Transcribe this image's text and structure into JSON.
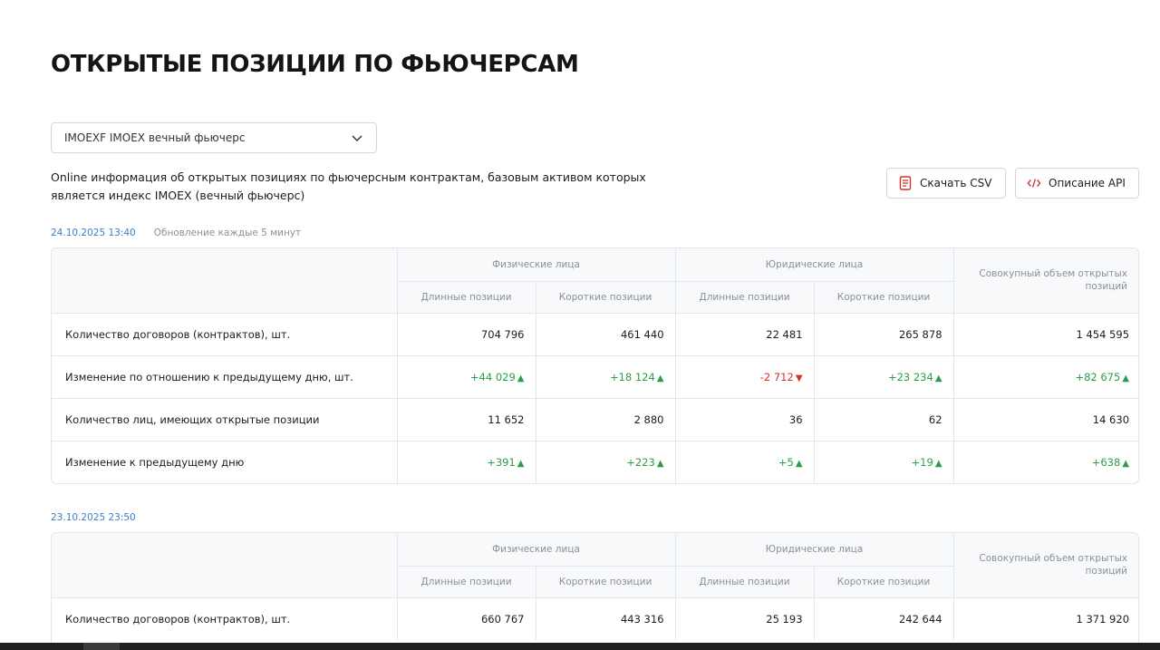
{
  "page": {
    "title": "ОТКРЫТЫЕ ПОЗИЦИИ ПО ФЬЮЧЕРСАМ",
    "description": "Online информация об открытых позициях по фьючерсным контрактам, базовым активом которых является индекс IMOEX (вечный фьючерс)"
  },
  "selector": {
    "value": "IMOEXF IMOEX вечный фьючерс",
    "icon": "chevron-down-icon"
  },
  "buttons": {
    "csv_label": "Скачать CSV",
    "csv_icon": "document-icon",
    "api_label": "Описание API",
    "api_icon": "code-icon"
  },
  "colors": {
    "accent": "#3c7fc4",
    "positive": "#2e9c4b",
    "negative": "#d32f2f",
    "api_icon": "#d32f2f"
  },
  "headers": {
    "individuals": "Физические лица",
    "legal": "Юридические лица",
    "long": "Длинные позиции",
    "short": "Короткие позиции",
    "total": "Совокупный объем открытых позиций"
  },
  "snapshots": [
    {
      "date": "24.10.2025 13:40",
      "note": "Обновление каждые 5 минут",
      "rows": [
        {
          "label": "Количество договоров (контрактов), шт.",
          "values": [
            "704 796",
            "461 440",
            "22 481",
            "265 878",
            "1 454 595"
          ]
        },
        {
          "label": "Изменение по отношению к предыдущему дню, шт.",
          "values": [
            "+44 029",
            "+18 124",
            "-2 712",
            "+23 234",
            "+82 675"
          ],
          "trend": [
            "up",
            "up",
            "down",
            "up",
            "up"
          ]
        },
        {
          "label": "Количество лиц, имеющих открытые позиции",
          "values": [
            "11 652",
            "2 880",
            "36",
            "62",
            "14 630"
          ]
        },
        {
          "label": "Изменение к предыдущему дню",
          "values": [
            "+391",
            "+223",
            "+5",
            "+19",
            "+638"
          ],
          "trend": [
            "up",
            "up",
            "up",
            "up",
            "up"
          ]
        }
      ]
    },
    {
      "date": "23.10.2025 23:50",
      "note": "",
      "rows": [
        {
          "label": "Количество договоров (контрактов), шт.",
          "values": [
            "660 767",
            "443 316",
            "25 193",
            "242 644",
            "1 371 920"
          ]
        }
      ]
    }
  ]
}
